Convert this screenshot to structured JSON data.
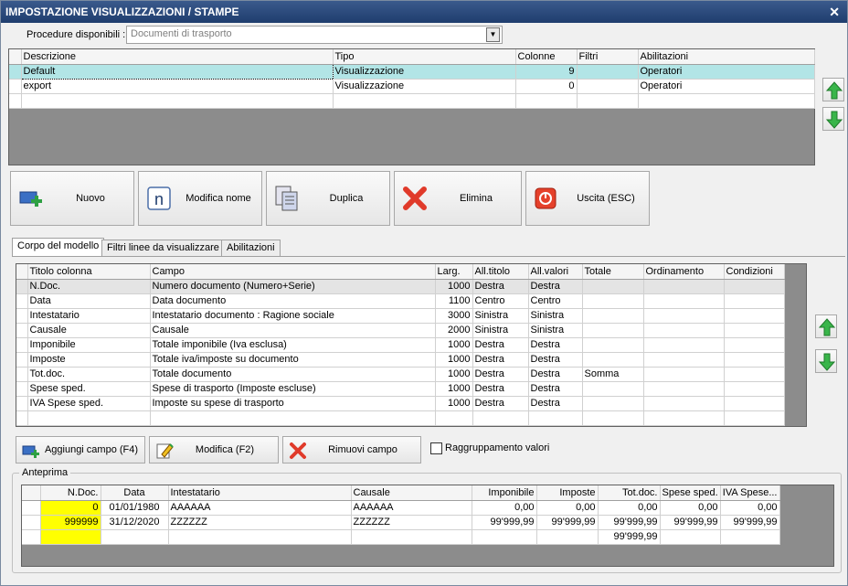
{
  "window": {
    "title": "IMPOSTAZIONE VISUALIZZAZIONI / STAMPE",
    "close_glyph": "✕"
  },
  "procedure": {
    "label": "Procedure disponibili :",
    "value": "Documenti di trasporto"
  },
  "views_grid": {
    "headers": [
      "Descrizione",
      "Tipo",
      "Colonne",
      "Filtri",
      "Abilitazioni"
    ],
    "rows": [
      [
        "Default",
        "Visualizzazione",
        "9",
        "",
        "Operatori"
      ],
      [
        "export",
        "Visualizzazione",
        "0",
        "",
        "Operatori"
      ]
    ]
  },
  "buttons": {
    "nuovo": "Nuovo",
    "modifica_nome": "Modifica nome",
    "duplica": "Duplica",
    "elimina": "Elimina",
    "uscita": "Uscita (ESC)"
  },
  "tabs": [
    "Corpo del modello",
    "Filtri linee da visualizzare",
    "Abilitazioni"
  ],
  "fields_grid": {
    "headers": [
      "Titolo colonna",
      "Campo",
      "Larg.",
      "All.titolo",
      "All.valori",
      "Totale",
      "Ordinamento",
      "Condizioni"
    ],
    "rows": [
      [
        "N.Doc.",
        "Numero documento (Numero+Serie)",
        "1000",
        "Destra",
        "Destra",
        "",
        "",
        ""
      ],
      [
        "Data",
        "Data documento",
        "1100",
        "Centro",
        "Centro",
        "",
        "",
        ""
      ],
      [
        "Intestatario",
        "Intestatario documento : Ragione sociale",
        "3000",
        "Sinistra",
        "Sinistra",
        "",
        "",
        ""
      ],
      [
        "Causale",
        "Causale",
        "2000",
        "Sinistra",
        "Sinistra",
        "",
        "",
        ""
      ],
      [
        "Imponibile",
        "Totale imponibile (Iva esclusa)",
        "1000",
        "Destra",
        "Destra",
        "",
        "",
        ""
      ],
      [
        "Imposte",
        "Totale iva/imposte su documento",
        "1000",
        "Destra",
        "Destra",
        "",
        "",
        ""
      ],
      [
        "Tot.doc.",
        "Totale documento",
        "1000",
        "Destra",
        "Destra",
        "Somma",
        "",
        ""
      ],
      [
        "Spese sped.",
        "Spese di trasporto (Imposte escluse)",
        "1000",
        "Destra",
        "Destra",
        "",
        "",
        ""
      ],
      [
        "IVA Spese sped.",
        "Imposte su spese di trasporto",
        "1000",
        "Destra",
        "Destra",
        "",
        "",
        ""
      ]
    ]
  },
  "field_buttons": {
    "aggiungi": "Aggiungi campo (F4)",
    "modifica": "Modifica (F2)",
    "rimuovi": "Rimuovi campo"
  },
  "raggruppamento": {
    "label": "Raggruppamento valori",
    "checked": false
  },
  "preview": {
    "label": "Anteprima",
    "headers": [
      "N.Doc.",
      "Data",
      "Intestatario",
      "Causale",
      "Imponibile",
      "Imposte",
      "Tot.doc.",
      "Spese sped.",
      "IVA Spese..."
    ],
    "rows": [
      [
        "0",
        "01/01/1980",
        "AAAAAA",
        "AAAAAA",
        "0,00",
        "0,00",
        "0,00",
        "0,00",
        "0,00"
      ],
      [
        "999999",
        "31/12/2020",
        "ZZZZZZ",
        "ZZZZZZ",
        "99'999,99",
        "99'999,99",
        "99'999,99",
        "99'999,99",
        "99'999,99"
      ],
      [
        "",
        "",
        "",
        "",
        "",
        "",
        "99'999,99",
        "",
        ""
      ]
    ]
  },
  "colors": {
    "selected_row": "#b2e5e6",
    "highlight_cell": "#ffff00",
    "titlebar": "#2c4a7c"
  }
}
